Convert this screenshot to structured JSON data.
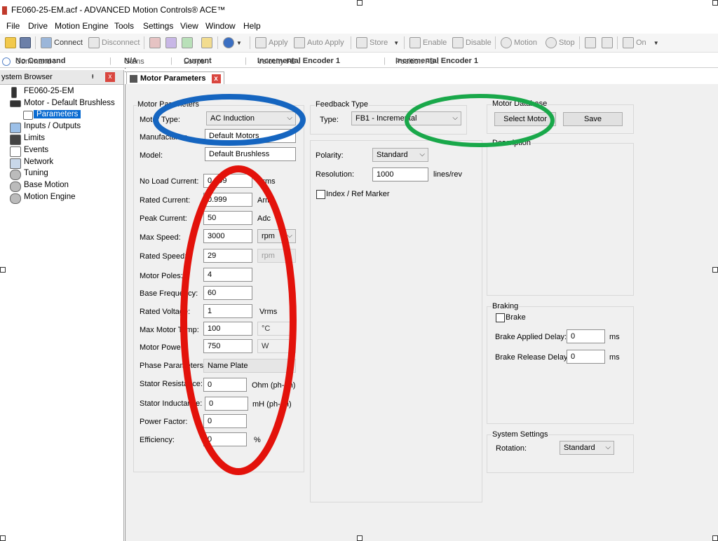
{
  "window": {
    "title": "FE060-25-EM.acf - ADVANCED Motion Controls® ACE™"
  },
  "menu": [
    "File",
    "Drive",
    "Motion Engine",
    "Tools",
    "Settings",
    "View",
    "Window",
    "Help"
  ],
  "toolbar": {
    "connect": "Connect",
    "disconnect": "Disconnect",
    "apply": "Apply",
    "auto_apply": "Auto Apply",
    "store": "Store",
    "enable": "Enable",
    "disable": "Disable",
    "motion": "Motion",
    "stop": "Stop",
    "on": "On"
  },
  "status": {
    "command_label": "Command :",
    "command_value": "No Command",
    "gains_label": "Gains :",
    "gains_value": "N/A",
    "loops_label": "Loops :",
    "loops_value": "Current",
    "vel_label": "Velocity FB :",
    "vel_value": "Incremental Encoder 1",
    "pos_label": "Position FB :",
    "pos_value": "Incremental Encoder 1"
  },
  "system_browser": {
    "title": "ystem Browser",
    "pin": "ᵻ",
    "close": "x",
    "items": [
      {
        "label": "FE060-25-EM"
      },
      {
        "label": "Motor - Default Brushless"
      },
      {
        "label": "Parameters"
      },
      {
        "label": "Inputs / Outputs"
      },
      {
        "label": "Limits"
      },
      {
        "label": "Events"
      },
      {
        "label": "Network"
      },
      {
        "label": "Tuning"
      },
      {
        "label": "Base Motion"
      },
      {
        "label": "Motion Engine"
      }
    ]
  },
  "tab": {
    "label": "Motor Parameters",
    "close": "x"
  },
  "motor_params": {
    "group_label": "Motor Parameters",
    "motor_type_label": "Motor Type:",
    "motor_type_value": "AC Induction",
    "manufacturer_label": "Manufacturer:",
    "manufacturer_value": "Default Motors",
    "model_label": "Model:",
    "model_value": "Default Brushless",
    "no_load_current_label": "No Load Current:",
    "no_load_current_value": "0.999",
    "no_load_current_unit": "Arms",
    "rated_current_label": "Rated Current:",
    "rated_current_value": "0.999",
    "rated_current_unit": "Arms",
    "peak_current_label": "Peak Current:",
    "peak_current_value": "50",
    "peak_current_unit": "Adc",
    "max_speed_label": "Max Speed:",
    "max_speed_value": "3000",
    "max_speed_unit": "rpm",
    "rated_speed_label": "Rated Speed:",
    "rated_speed_value": "29",
    "rated_speed_unit": "rpm",
    "motor_poles_label": "Motor Poles:",
    "motor_poles_value": "4",
    "base_freq_label": "Base Frequency:",
    "base_freq_value": "60",
    "rated_voltage_label": "Rated Voltage:",
    "rated_voltage_value": "1",
    "rated_voltage_unit": "Vrms",
    "max_motor_temp_label": "Max Motor Temp:",
    "max_motor_temp_value": "100",
    "max_motor_temp_unit": "°C",
    "motor_power_label": "Motor Power:",
    "motor_power_value": "750",
    "motor_power_unit": "W",
    "phase_params_label": "Phase Parameters:",
    "phase_params_value": "Name Plate",
    "stator_res_label": "Stator Resistance:",
    "stator_res_value": "0",
    "stator_res_unit": "Ohm (ph-ph)",
    "stator_ind_label": "Stator Inductance:",
    "stator_ind_value": "0",
    "stator_ind_unit": "mH (ph-ph)",
    "power_factor_label": "Power Factor:",
    "power_factor_value": "0",
    "efficiency_label": "Efficiency:",
    "efficiency_value": "0",
    "efficiency_unit": "%"
  },
  "feedback": {
    "group_label": "Feedback Type",
    "type_label": "Type:",
    "type_value": "FB1 - Incremental",
    "polarity_label": "Polarity:",
    "polarity_value": "Standard",
    "resolution_label": "Resolution:",
    "resolution_value": "1000",
    "resolution_unit": "lines/rev",
    "index_label": "Index / Ref Marker"
  },
  "motor_database": {
    "group_label": "Motor Database",
    "select_motor": "Select Motor",
    "save": "Save",
    "description_label": "Description"
  },
  "braking": {
    "group_label": "Braking",
    "brake_label": "Brake",
    "applied_delay_label": "Brake Applied Delay:",
    "applied_delay_value": "0",
    "applied_delay_unit": "ms",
    "release_delay_label": "Brake Release Delay:",
    "release_delay_value": "0",
    "release_delay_unit": "ms"
  },
  "system_settings": {
    "group_label": "System Settings",
    "rotation_label": "Rotation:",
    "rotation_value": "Standard"
  },
  "annotations": {
    "blue": "#1565c0",
    "green": "#19a84a",
    "red": "#e3120b"
  }
}
